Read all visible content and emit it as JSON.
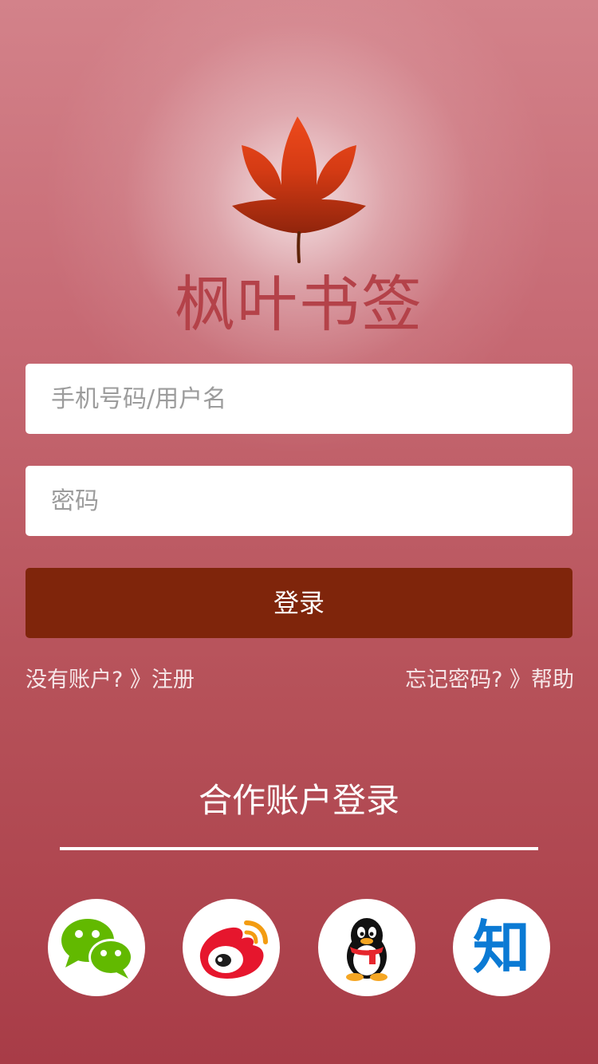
{
  "app": {
    "title": "枫叶书签"
  },
  "form": {
    "username_placeholder": "手机号码/用户名",
    "password_placeholder": "密码",
    "login_label": "登录"
  },
  "links": {
    "register": "没有账户? 》注册",
    "forgot": "忘记密码? 》帮助"
  },
  "partner": {
    "title": "合作账户登录",
    "zhihu_glyph": "知"
  },
  "icons": {
    "logo": "maple-leaf-icon",
    "wechat": "wechat-icon",
    "weibo": "weibo-icon",
    "qq": "qq-penguin-icon",
    "zhihu": "zhihu-icon"
  },
  "colors": {
    "login_button": "#7f250b",
    "title_text": "#b44249",
    "wechat_green": "#62b900",
    "weibo_red": "#e6162d",
    "weibo_orange": "#f39c12",
    "zhihu_blue": "#0b7ad4"
  }
}
